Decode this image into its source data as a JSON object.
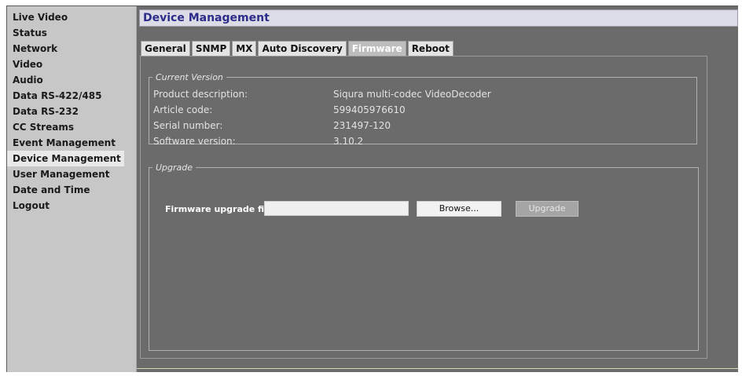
{
  "sidebar": {
    "items": [
      {
        "label": "Live Video"
      },
      {
        "label": "Status"
      },
      {
        "label": "Network"
      },
      {
        "label": "Video"
      },
      {
        "label": "Audio"
      },
      {
        "label": "Data RS-422/485"
      },
      {
        "label": "Data RS-232"
      },
      {
        "label": "CC Streams"
      },
      {
        "label": "Event Management"
      },
      {
        "label": "Device Management",
        "active": true
      },
      {
        "label": "User Management"
      },
      {
        "label": "Date and Time"
      },
      {
        "label": "Logout"
      }
    ]
  },
  "header": {
    "title": "Device Management"
  },
  "tabs": [
    {
      "label": "General"
    },
    {
      "label": "SNMP"
    },
    {
      "label": "MX"
    },
    {
      "label": "Auto Discovery"
    },
    {
      "label": "Firmware",
      "active": true
    },
    {
      "label": "Reboot"
    }
  ],
  "current_version": {
    "legend": "Current Version",
    "rows": [
      {
        "label": "Product description:",
        "value": "Siqura multi-codec VideoDecoder"
      },
      {
        "label": "Article code:",
        "value": "599405976610"
      },
      {
        "label": "Serial number:",
        "value": "231497-120"
      },
      {
        "label": "Software version:",
        "value": "3.10.2"
      }
    ]
  },
  "upgrade": {
    "legend": "Upgrade",
    "file_label": "Firmware upgrade file:",
    "file_value": "",
    "browse_label": "Browse...",
    "upgrade_label": "Upgrade"
  },
  "colors": {
    "content_bg": "#6b6b6b",
    "sidebar_bg": "#c7c7c7",
    "title_text": "#2c2c8a"
  }
}
